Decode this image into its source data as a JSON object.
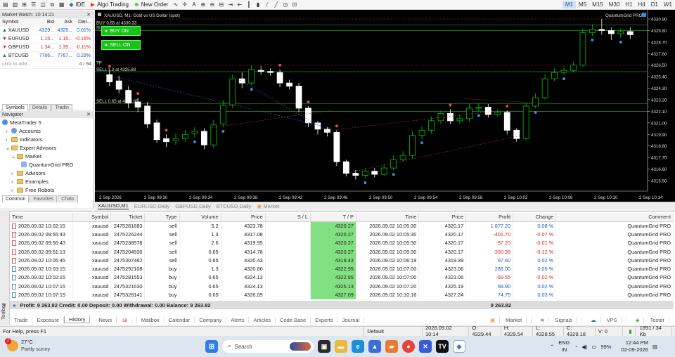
{
  "toolbar": {
    "ide": "IDE",
    "algo_trading": "Algo Trading",
    "new_order": "New Order",
    "timeframes": [
      "M1",
      "M5",
      "M15",
      "M30",
      "H1",
      "H4",
      "D1",
      "W1"
    ],
    "active_tf": "M1"
  },
  "market_watch": {
    "title": "Market Watch: 10:14:21",
    "headers": [
      "Symbol",
      "Bid",
      "Ask",
      "Dail..."
    ],
    "rows": [
      {
        "symbol": "XAUUSD",
        "bid": "4329...",
        "ask": "4329...",
        "daily": "0.01%",
        "color": "blue"
      },
      {
        "symbol": "EURUSD",
        "bid": "1.15...",
        "ask": "1.15...",
        "daily": "-0.16%",
        "color": "red"
      },
      {
        "symbol": "GBPUSD",
        "bid": "1.34...",
        "ask": "1.35...",
        "daily": "-0.11%",
        "color": "red"
      },
      {
        "symbol": "BTCUSD",
        "bid": "7766...",
        "ask": "7767...",
        "daily": "0.29%",
        "color": "blue"
      }
    ],
    "add_placeholder": "click to add...",
    "count": "4 / 94",
    "tabs": [
      "Symbols",
      "Details",
      "Tradin"
    ]
  },
  "navigator": {
    "title": "Navigator",
    "items": [
      "MetaTrader 5",
      "Accounts",
      "Indicators",
      "Expert Advisors",
      "Market",
      "QuantumGrid PRO",
      "Advisors",
      "Examples",
      "Free Robots"
    ],
    "tabs": [
      "Common",
      "Favorites",
      "Chats"
    ]
  },
  "chart": {
    "title": "XAUUSD, M1:  Gold vs US Dollar (spot)",
    "ea_name": "QuantumGrid PRO",
    "buy_line": "BUY 0.65 at 4330.33",
    "sl_label": "SL",
    "tp_label": "TP",
    "sell_line_1": "SELL 1.3 at 4325.88",
    "sell_line_2": "SELL 0.65 at 4322.85",
    "buy_on": "BUY ON",
    "sell_on": "SELL ON",
    "price_labels": [
      "4330.90",
      "4329.80",
      "4328.70",
      "4327.60",
      "4326.50",
      "4325.40",
      "4324.30",
      "4323.20",
      "4322.10",
      "4321.00",
      "4319.90",
      "4318.80",
      "4317.70",
      "4316.60",
      "4315.50"
    ],
    "time_labels": [
      "2 Sep 2026",
      "2 Sep 09:30",
      "2 Sep 09:34",
      "2 Sep 09:38",
      "2 Sep 09:42",
      "2 Sep 09:46",
      "2 Sep 09:50",
      "2 Sep 09:54",
      "2 Sep 09:58",
      "2 Sep 10:02",
      "2 Sep 10:06",
      "2 Sep 10:10",
      "2 Sep 10:14"
    ],
    "colors": {
      "bg": "#000000",
      "bull": "#00c800",
      "bear": "#ffffff",
      "grid": "#1e1e1e",
      "hline": "#1e8a1e",
      "sl": "#7a1a1a"
    }
  },
  "chart_tabs": [
    "XAUUSD,M1",
    "EURUSD,Daily",
    "GBPUSD,Daily",
    "BTCUSD,Daily",
    "Market"
  ],
  "history": {
    "headers": [
      "Time",
      "Symbol",
      "Ticket",
      "Type",
      "Volume",
      "Price",
      "S / L",
      "T / P",
      "Time",
      "Price",
      "Profit",
      "Change",
      "Comment"
    ],
    "rows": [
      [
        "2026.09.02 10:02:15",
        "xauusd",
        "2475281683",
        "sell",
        "5.2",
        "4323.78",
        "",
        "4320.27",
        "2026.09.02 10:05:30",
        "4320.17",
        "1 877.20",
        "0.08 %",
        "QuantumGrid PRO"
      ],
      [
        "2026.09.02 09:55:43",
        "xauusd",
        "2475226244",
        "sell",
        "1.3",
        "4317.08",
        "",
        "4320.27",
        "2026.09.02 10:05:30",
        "4320.17",
        "-401.70",
        "-0.07 %",
        "QuantumGrid PRO"
      ],
      [
        "2026.09.02 09:56:43",
        "xauusd",
        "2475238578",
        "sell",
        "2.6",
        "4319.95",
        "",
        "4320.27",
        "2026.09.02 10:05:30",
        "4320.17",
        "-57.20",
        "-0.01 %",
        "QuantumGrid PRO"
      ],
      [
        "2026.09.02 09:51:13",
        "xauusd",
        "2475204930",
        "sell",
        "0.65",
        "4314.78",
        "",
        "4320.27",
        "2026.09.02 10:05:30",
        "4320.17",
        "-350.35",
        "-0.12 %",
        "QuantumGrid PRO"
      ],
      [
        "2026.09.02 10:05:45",
        "xauusd",
        "2475307462",
        "sell",
        "0.65",
        "4320.43",
        "",
        "4319.43",
        "2026.09.02 10:06:19",
        "4319.39",
        "67.60",
        "0.02 %",
        "QuantumGrid PRO"
      ],
      [
        "2026.09.02 10:03:15",
        "xauusd",
        "2475292108",
        "buy",
        "1.3",
        "4320.86",
        "",
        "4322.95",
        "2026.09.02 10:07:00",
        "4323.06",
        "286.00",
        "0.05 %",
        "QuantumGrid PRO"
      ],
      [
        "2026.09.02 10:02:15",
        "xauusd",
        "2475281553",
        "buy",
        "0.65",
        "4324.13",
        "",
        "4322.95",
        "2026.09.02 10:07:00",
        "4323.06",
        "-69.55",
        "-0.02 %",
        "QuantumGrid PRO"
      ],
      [
        "2026.09.02 10:07:15",
        "xauusd",
        "2475321630",
        "buy",
        "0.65",
        "4324.13",
        "",
        "4325.13",
        "2026.09.02 10:07:20",
        "4325.19",
        "68.90",
        "0.02 %",
        "QuantumGrid PRO"
      ],
      [
        "2026.09.02 10:07:15",
        "xauusd",
        "2475328141",
        "buy",
        "0.65",
        "4326.09",
        "",
        "4327.09",
        "2026.09.02 10:10:16",
        "4327.24",
        "74.75",
        "0.03 %",
        "QuantumGrid PRO"
      ]
    ],
    "summary": "Profit: 9 263.82  Credit: 0.00  Deposit: 0.00  Withdrawal: 0.00  Balance: 9 263.82",
    "summary_total": "9 263.82",
    "toolbox_label": "Toolbox",
    "bottom_tabs": [
      "Trade",
      "Exposure",
      "History",
      "News",
      "Mailbox",
      "Calendar",
      "Company",
      "Alerts",
      "Articles",
      "Code Base",
      "Experts",
      "Journal"
    ],
    "news_badge": "56",
    "right_tabs": [
      "Market",
      "Signals",
      "VPS",
      "Tester"
    ]
  },
  "status": {
    "help": "For Help, press F1",
    "profile": "Default",
    "time": "2026.09.02 10:14",
    "open": "O: 4329.44",
    "high": "H: 4329.54",
    "low": "L: 4328.55",
    "close": "C: 4329.18",
    "volume": "V: 0",
    "traffic": "1891 / 34 Kb"
  },
  "taskbar": {
    "temp": "27°C",
    "weather": "Partly sunny",
    "weather_badge": "2",
    "search_placeholder": "Search",
    "lang1": "ENG",
    "lang2": "IN",
    "battery": "99%",
    "clock_time": "12:44 PM",
    "clock_date": "02-09-2026"
  }
}
